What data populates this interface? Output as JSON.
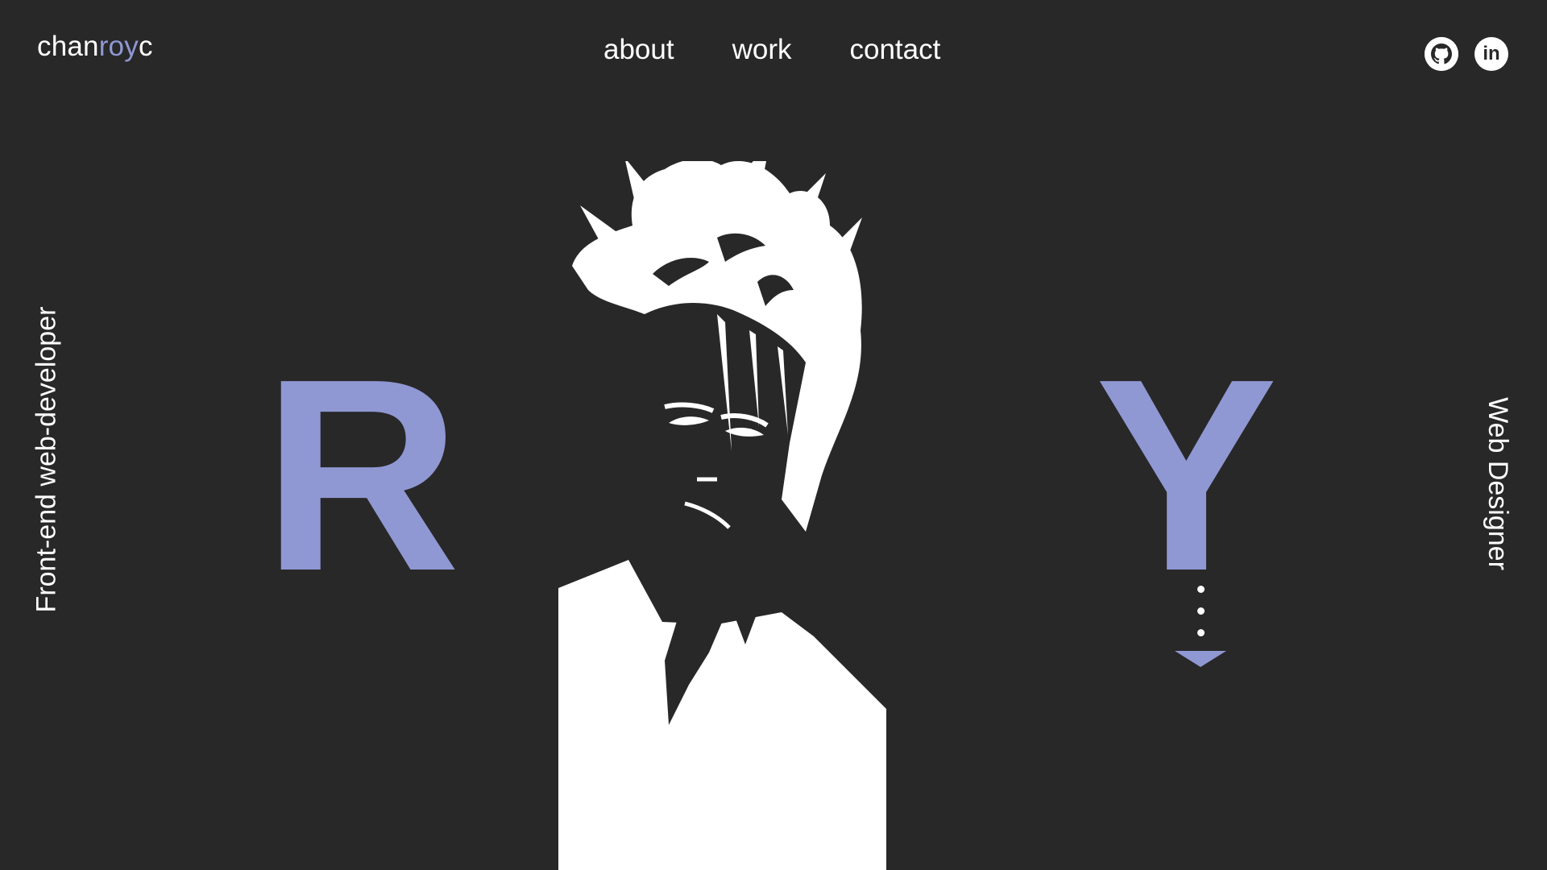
{
  "logo": {
    "prefix": "chan",
    "accent": "roy",
    "suffix": "c"
  },
  "nav": {
    "items": [
      "about",
      "work",
      "contact"
    ]
  },
  "social": {
    "github_icon": "github-icon",
    "linkedin_icon": "linkedin-icon",
    "linkedin_label": "in"
  },
  "hero": {
    "letter_left": "R",
    "letter_right": "Y",
    "side_left": "Front-end web-developer",
    "side_right": "Web Designer"
  },
  "colors": {
    "background": "#282828",
    "accent": "#8f98d3",
    "text": "#ffffff"
  }
}
